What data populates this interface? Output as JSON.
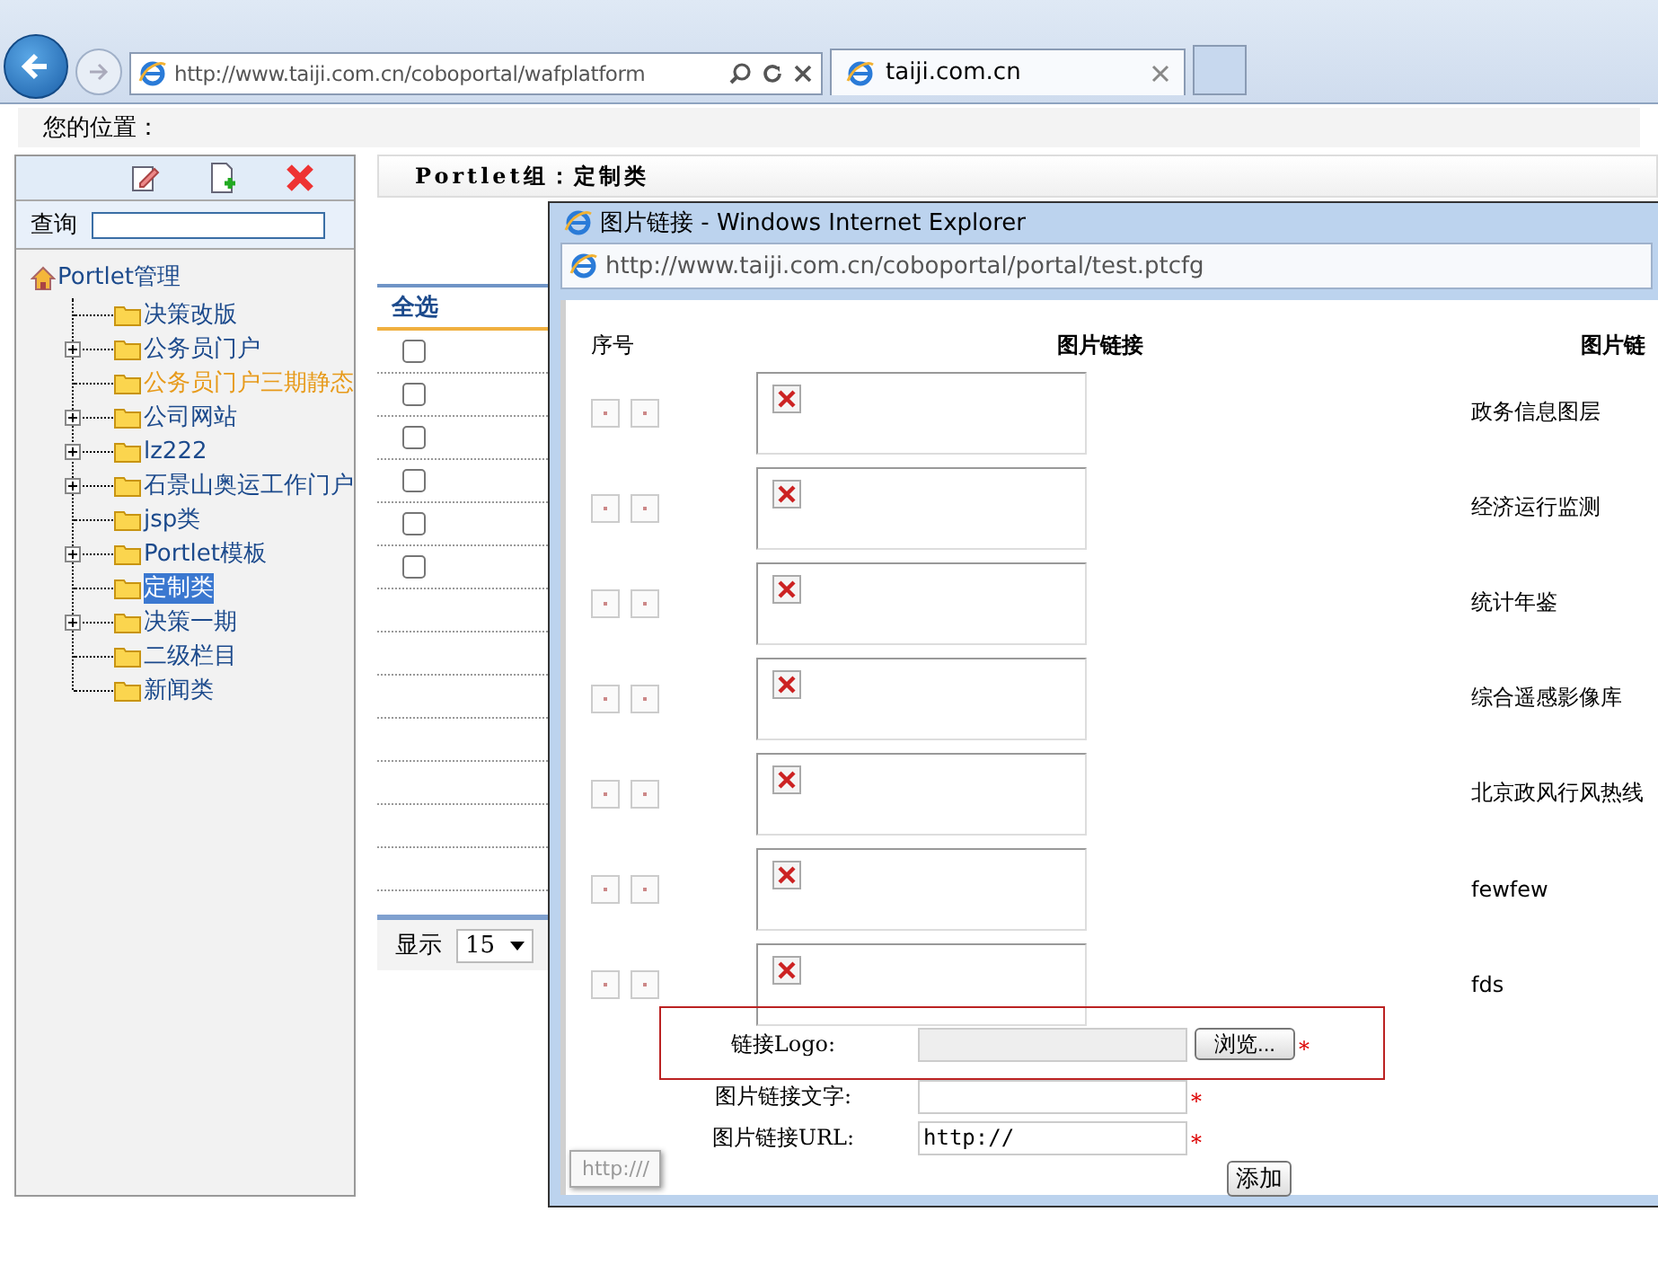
{
  "browser": {
    "address": "http://www.taiji.com.cn/coboportal/wafplatform",
    "tabs": [
      {
        "title": "taiji.com.cn"
      }
    ]
  },
  "breadcrumb": {
    "label": "您的位置："
  },
  "sidebar": {
    "search_label": "查询",
    "tree": {
      "label": "Portlet管理",
      "children": [
        {
          "label": "决策改版",
          "expandable": false,
          "selected": false,
          "hovered": false
        },
        {
          "label": "公务员门户",
          "expandable": true,
          "selected": false,
          "hovered": false
        },
        {
          "label": "公务员门户三期静态",
          "expandable": false,
          "selected": false,
          "hovered": true
        },
        {
          "label": "公司网站",
          "expandable": true,
          "selected": false,
          "hovered": false
        },
        {
          "label": "lz222",
          "expandable": true,
          "selected": false,
          "hovered": false
        },
        {
          "label": "石景山奥运工作门户",
          "expandable": true,
          "selected": false,
          "hovered": false
        },
        {
          "label": "jsp类",
          "expandable": false,
          "selected": false,
          "hovered": false
        },
        {
          "label": "Portlet模板",
          "expandable": true,
          "selected": false,
          "hovered": false
        },
        {
          "label": "定制类",
          "expandable": false,
          "selected": true,
          "hovered": false
        },
        {
          "label": "决策一期",
          "expandable": true,
          "selected": false,
          "hovered": false
        },
        {
          "label": "二级栏目",
          "expandable": false,
          "selected": false,
          "hovered": false
        },
        {
          "label": "新闻类",
          "expandable": false,
          "selected": false,
          "hovered": false
        }
      ]
    }
  },
  "main": {
    "heading": "Portlet组：定制类",
    "select_all": "全选",
    "rows": [
      {
        "checked": false
      },
      {
        "checked": false
      },
      {
        "checked": false
      },
      {
        "checked": false
      },
      {
        "checked": false
      },
      {
        "checked": false
      }
    ],
    "pager": {
      "label": "显示",
      "page_size": "15"
    }
  },
  "popup": {
    "title": "图片链接 - Windows Internet Explorer",
    "address": "http://www.taiji.com.cn/coboportal/portal/test.ptcfg",
    "columns": [
      "序号",
      "图片链接",
      "图片链"
    ],
    "rows": [
      {
        "name": "政务信息图层"
      },
      {
        "name": "经济运行监测"
      },
      {
        "name": "统计年鉴"
      },
      {
        "name": "综合遥感影像库"
      },
      {
        "name": "北京政风行风热线"
      },
      {
        "name": "fewfew"
      },
      {
        "name": "fds"
      }
    ],
    "form": {
      "logo_label": "链接Logo:",
      "browse": "浏览...",
      "text_label": "图片链接文字:",
      "url_label": "图片链接URL:",
      "url_value": "http://",
      "required": "*",
      "submit": "添加"
    },
    "status": "http:///"
  }
}
